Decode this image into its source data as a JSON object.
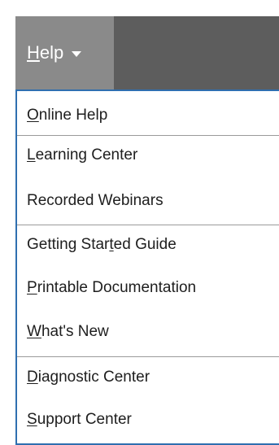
{
  "menubar": {
    "help_label_first": "H",
    "help_label_rest": "elp"
  },
  "menu": {
    "items": [
      {
        "u": "O",
        "rest": "nline Help"
      },
      {
        "u": "L",
        "rest": "earning Center"
      },
      {
        "pre": "Recorded Webinars"
      },
      {
        "pre": "Getting Star",
        "u": "t",
        "rest": "ed Guide"
      },
      {
        "u": "P",
        "rest": "rintable Documentation"
      },
      {
        "u": "W",
        "rest": "hat's New"
      },
      {
        "u": "D",
        "rest": "iagnostic Center"
      },
      {
        "u": "S",
        "rest": "upport Center"
      }
    ]
  },
  "colors": {
    "menubar_bg": "#5d5d5d",
    "help_tab_bg": "#8a8a8a",
    "menu_border": "#2f6fb0",
    "text": "#1e1e1e"
  }
}
